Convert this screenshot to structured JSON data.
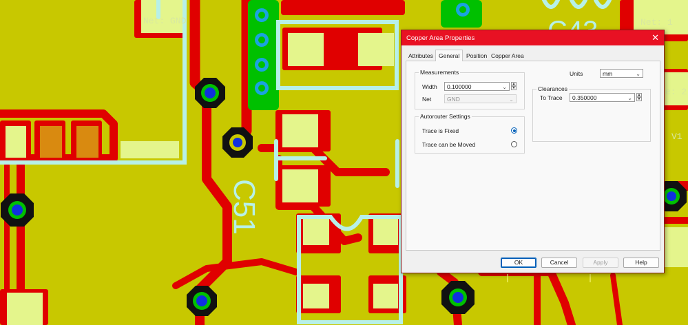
{
  "dialog": {
    "title": "Copper Area Properties",
    "close_glyph": "✕",
    "tabs": [
      {
        "label": "Attributes",
        "active": false
      },
      {
        "label": "General",
        "active": true
      },
      {
        "label": "Position",
        "active": false
      },
      {
        "label": "Copper Area",
        "active": false
      }
    ],
    "measurements": {
      "legend": "Measurements",
      "width_label": "Width",
      "width_value": "0.100000",
      "net_label": "Net",
      "net_value": "GND"
    },
    "autorouter": {
      "legend": "Autorouter Settings",
      "options": [
        {
          "label": "Trace is Fixed",
          "checked": true
        },
        {
          "label": "Trace can be Moved",
          "checked": false
        }
      ]
    },
    "units": {
      "label": "Units",
      "value": "mm"
    },
    "clearances": {
      "legend": "Clearances",
      "to_trace_label": "To Trace",
      "to_trace_value": "0.350000"
    },
    "buttons": {
      "ok": "OK",
      "cancel": "Cancel",
      "apply": "Apply",
      "help": "Help"
    }
  },
  "board": {
    "silkscreen": {
      "ref_c51": "C51",
      "ref_c43": "C43",
      "net_gnd": "Net: GND",
      "net_1": "Net: 1",
      "edge_e2": "e: 2",
      "edge_v1": "V1"
    },
    "colors": {
      "copper_pour": "#c8c800",
      "trace": "#e00000",
      "silkscreen": "#b7f0e8",
      "pad": "#e4f58c",
      "via_ring": "#00c000",
      "via_hole": "#1030e0",
      "dialog_title": "#e81123",
      "selection_blue": "#005fb8"
    }
  }
}
